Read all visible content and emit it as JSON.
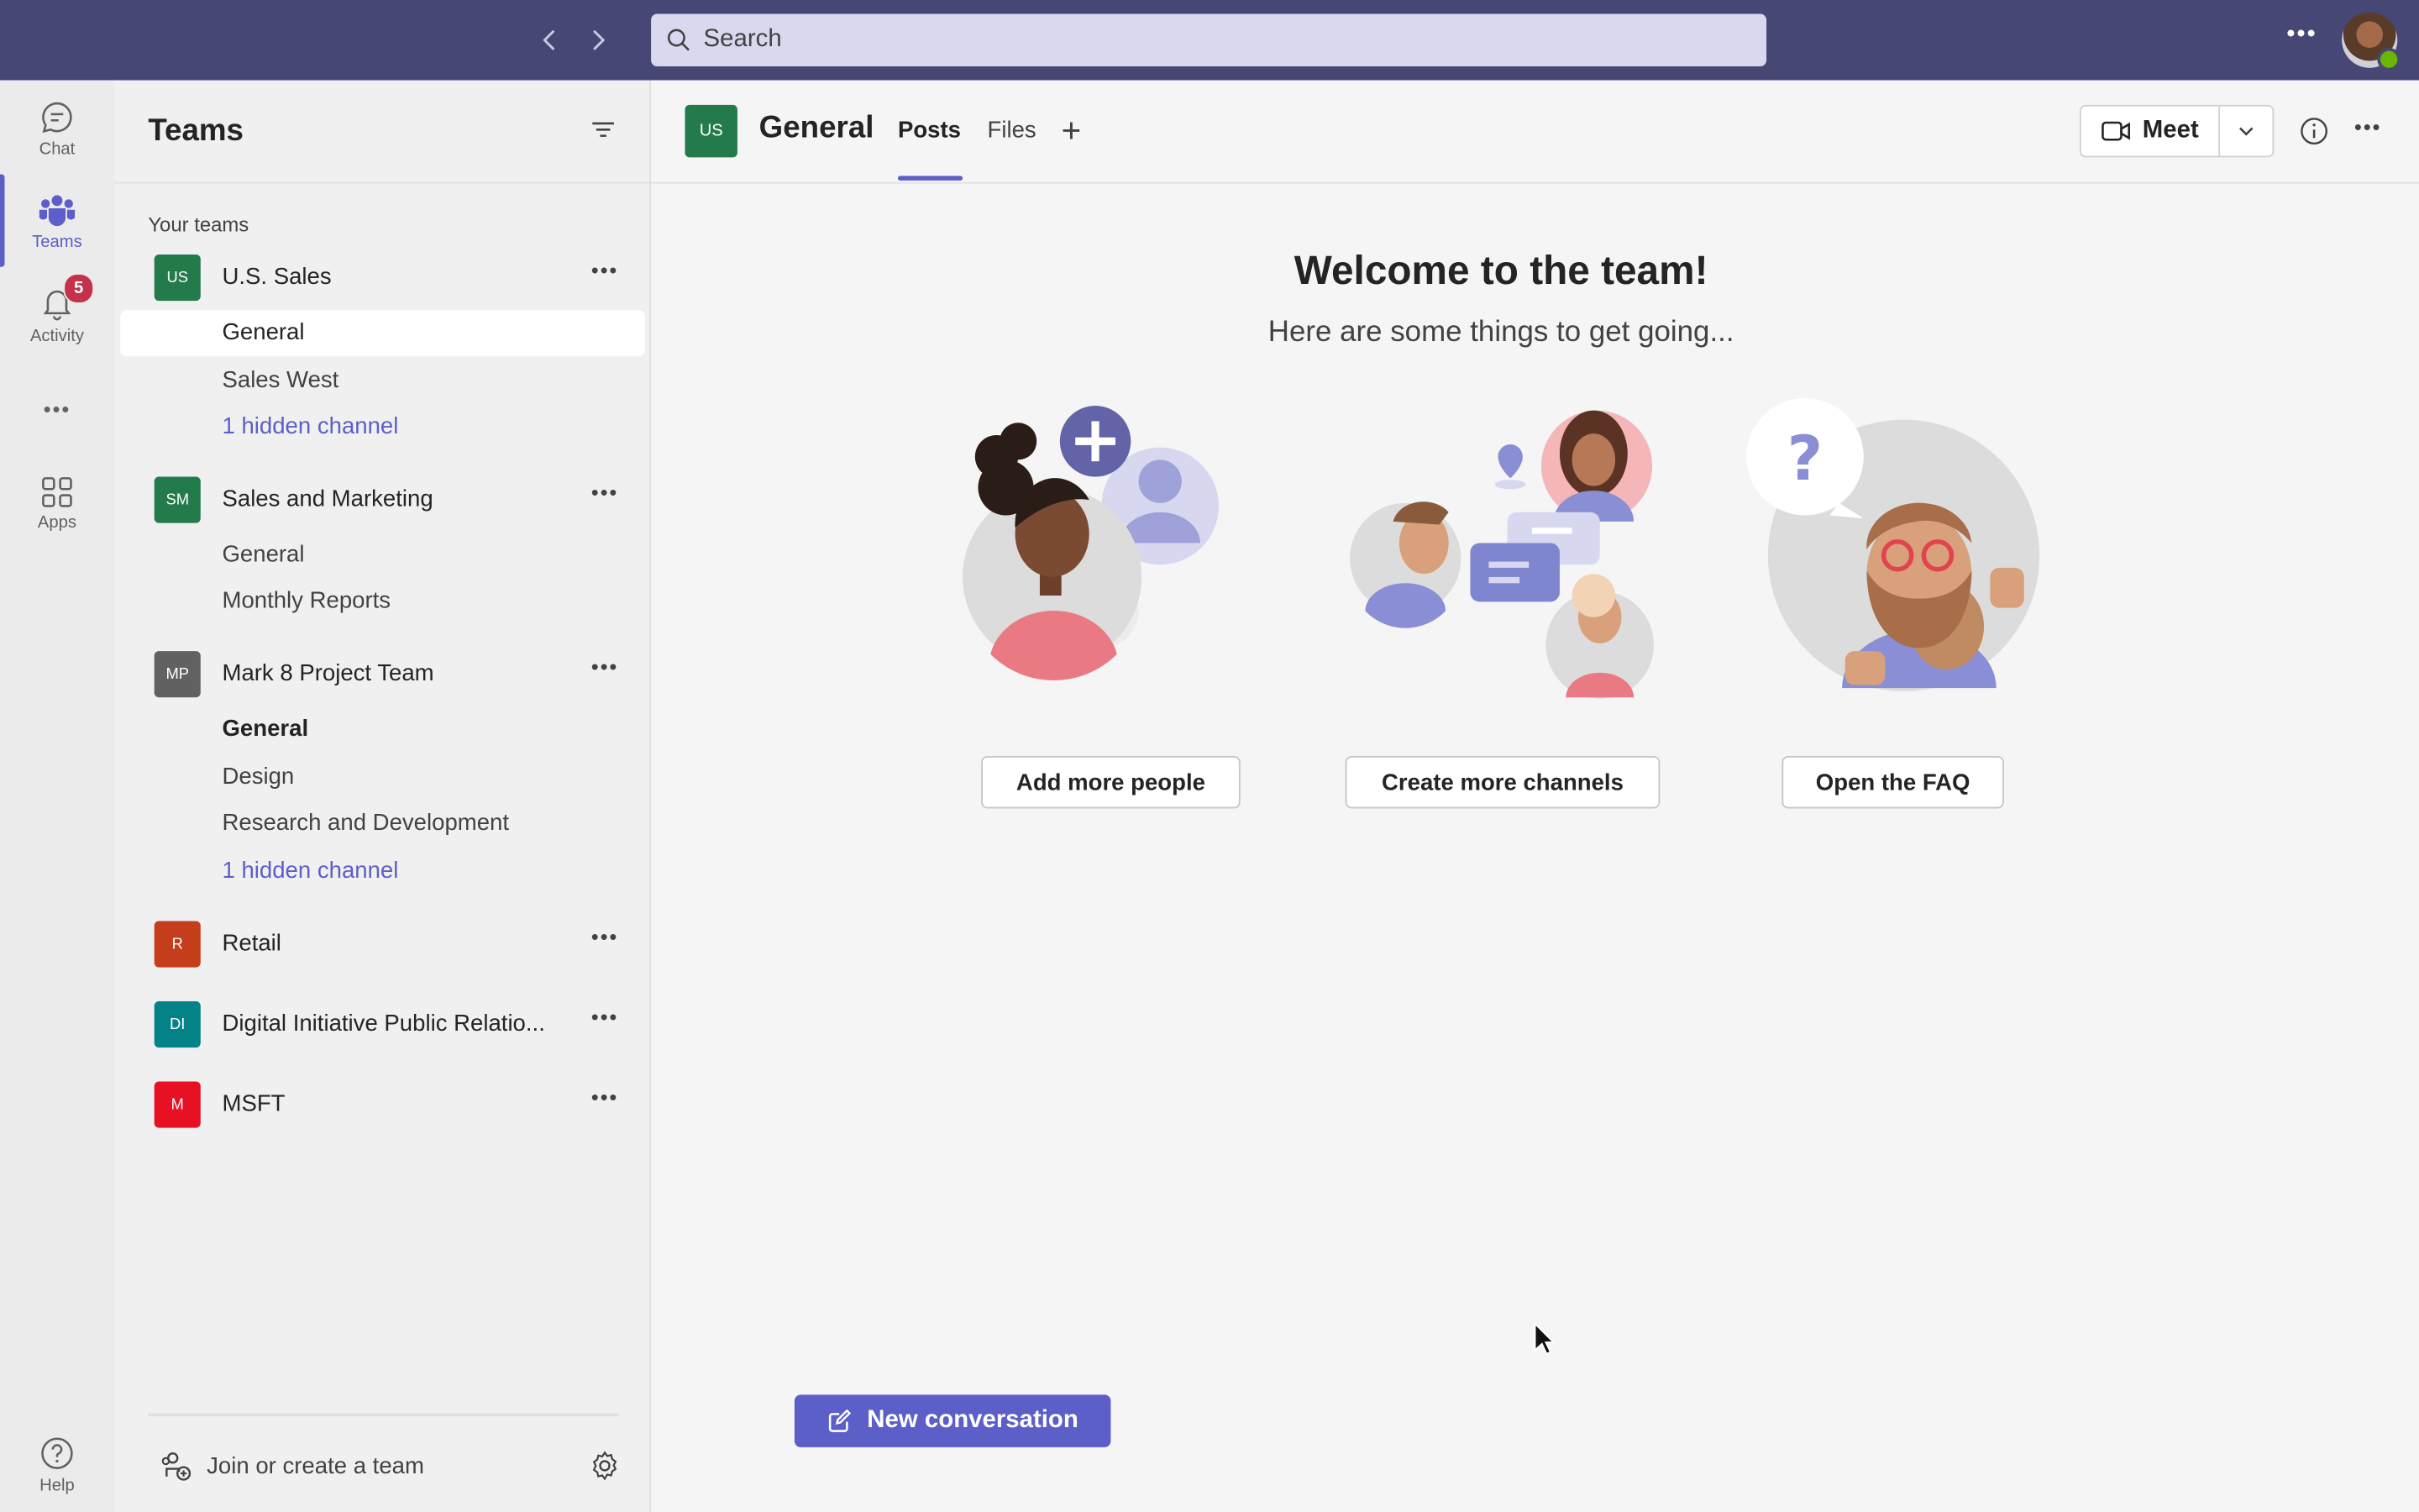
{
  "search": {
    "placeholder": "Search"
  },
  "rail": {
    "items": [
      {
        "label": "Chat",
        "icon": "chat-icon"
      },
      {
        "label": "Teams",
        "icon": "teams-icon",
        "active": true
      },
      {
        "label": "Activity",
        "icon": "bell-icon",
        "badge": "5"
      },
      {
        "label": "",
        "icon": "more-icon"
      },
      {
        "label": "Apps",
        "icon": "apps-icon"
      },
      {
        "label": "Help",
        "icon": "help-icon"
      }
    ]
  },
  "teamlist": {
    "title": "Teams",
    "section_label": "Your teams",
    "teams": [
      {
        "initials": "US",
        "name": "U.S. Sales",
        "color": "#237b4b",
        "channels": [
          "General",
          "Sales West",
          "1 hidden channel"
        ]
      },
      {
        "initials": "SM",
        "name": "Sales and Marketing",
        "color": "#237b4b",
        "channels": [
          "General",
          "Monthly Reports"
        ]
      },
      {
        "initials": "MP",
        "name": "Mark 8 Project Team",
        "color": "#616161",
        "channels": [
          "General",
          "Design",
          "Research and Development",
          "1 hidden channel"
        ]
      },
      {
        "initials": "R",
        "name": "Retail",
        "color": "#c43e1c",
        "channels": []
      },
      {
        "initials": "DI",
        "name": "Digital Initiative Public Relatio...",
        "color": "#038387",
        "channels": []
      },
      {
        "initials": "M",
        "name": "MSFT",
        "color": "#e81123",
        "channels": []
      }
    ],
    "join_label": "Join or create a team"
  },
  "channel_header": {
    "tile": "US",
    "name": "General",
    "tabs": [
      "Posts",
      "Files"
    ],
    "meet_label": "Meet"
  },
  "welcome": {
    "title": "Welcome to the team!",
    "subtitle": "Here are some things to get going...",
    "actions": [
      "Add more people",
      "Create more channels",
      "Open the FAQ"
    ]
  },
  "new_conversation_label": "New conversation",
  "colors": {
    "brand": "#464775",
    "accent": "#5b5fc7"
  }
}
